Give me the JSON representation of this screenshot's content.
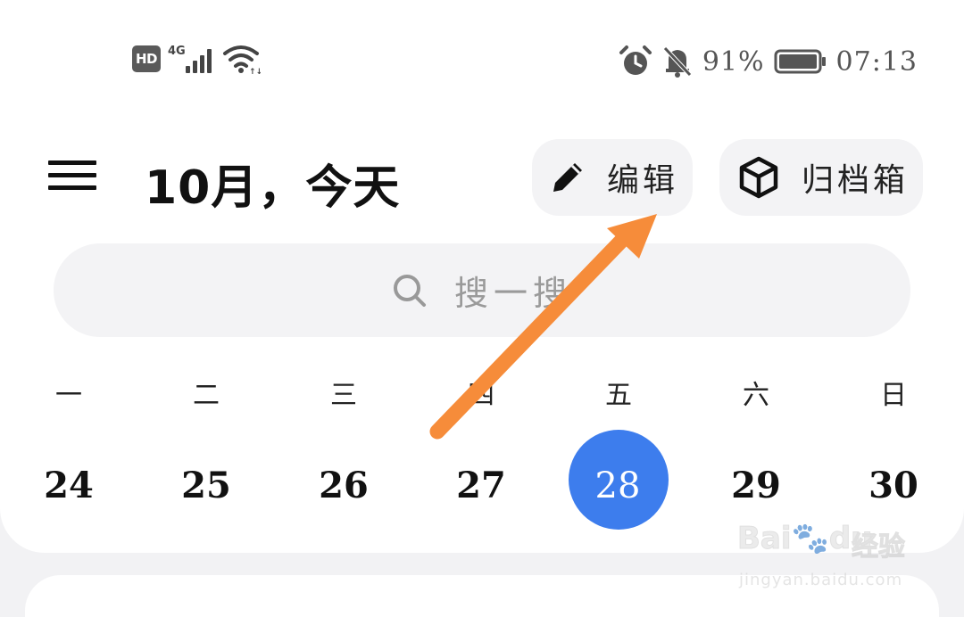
{
  "status_bar": {
    "hd": "HD",
    "network": "4G",
    "battery_percent": "91%",
    "time": "07:13",
    "icons": [
      "hd-icon",
      "signal-icon",
      "wifi-icon",
      "alarm-icon",
      "bell-off-icon",
      "battery-icon"
    ]
  },
  "header": {
    "title": "10月，今天",
    "edit_label": "编辑",
    "archive_label": "归档箱"
  },
  "search": {
    "placeholder": "搜一搜"
  },
  "week": {
    "headers": [
      "一",
      "二",
      "三",
      "四",
      "五",
      "六",
      "日"
    ],
    "days": [
      "24",
      "25",
      "26",
      "27",
      "28",
      "29",
      "30"
    ],
    "today_index": 4
  },
  "colors": {
    "accent": "#3d7ded",
    "arrow": "#f68c3a",
    "background": "#f2f2f4",
    "pill": "#f3f3f5"
  },
  "watermark": {
    "brand": "Bai",
    "brand2": "du",
    "cn": "经验",
    "url": "jingyan.baidu.com"
  }
}
